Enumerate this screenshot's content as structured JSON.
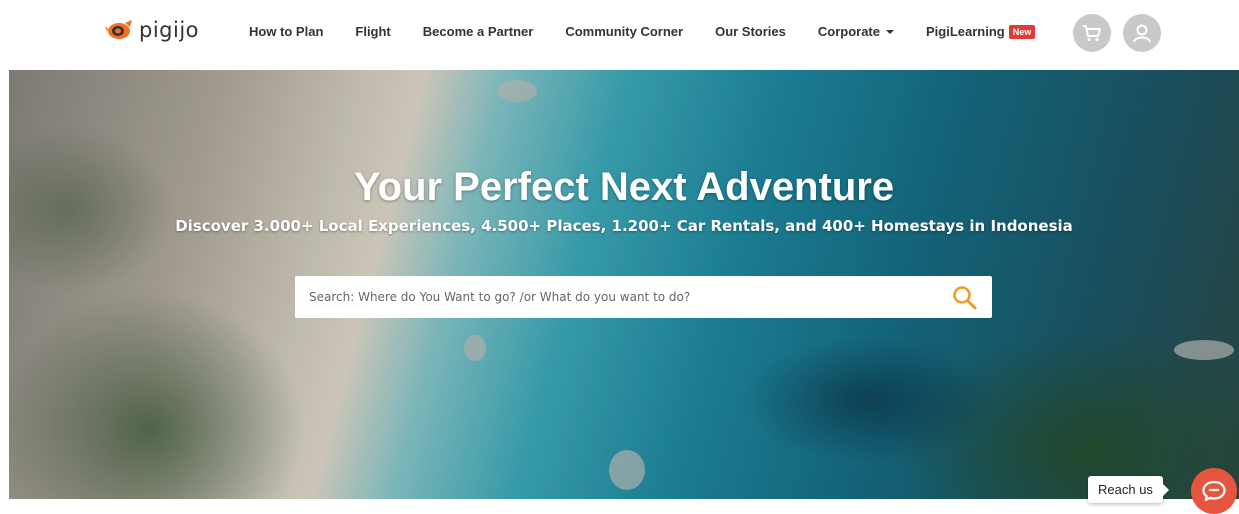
{
  "brand": {
    "name": "pigijo",
    "accent": "#f36f21"
  },
  "nav": {
    "items": [
      {
        "label": "How to Plan"
      },
      {
        "label": "Flight"
      },
      {
        "label": "Become a Partner"
      },
      {
        "label": "Community Corner"
      },
      {
        "label": "Our Stories"
      },
      {
        "label": "Corporate"
      },
      {
        "label": "PigiLearning",
        "badge": "New"
      }
    ],
    "cart_icon": "cart-icon",
    "user_icon": "user-icon"
  },
  "hero": {
    "title": "Your Perfect Next Adventure",
    "subtitle": "Discover 3.000+ Local Experiences, 4.500+ Places, 1.200+ Car Rentals,  and 400+ Homestays in Indonesia",
    "search": {
      "placeholder": "Search: Where do You Want to go? /or What do you want to do?",
      "value": ""
    }
  },
  "reach": {
    "label": "Reach us",
    "icon": "chat-icon",
    "color": "#e8553e"
  }
}
